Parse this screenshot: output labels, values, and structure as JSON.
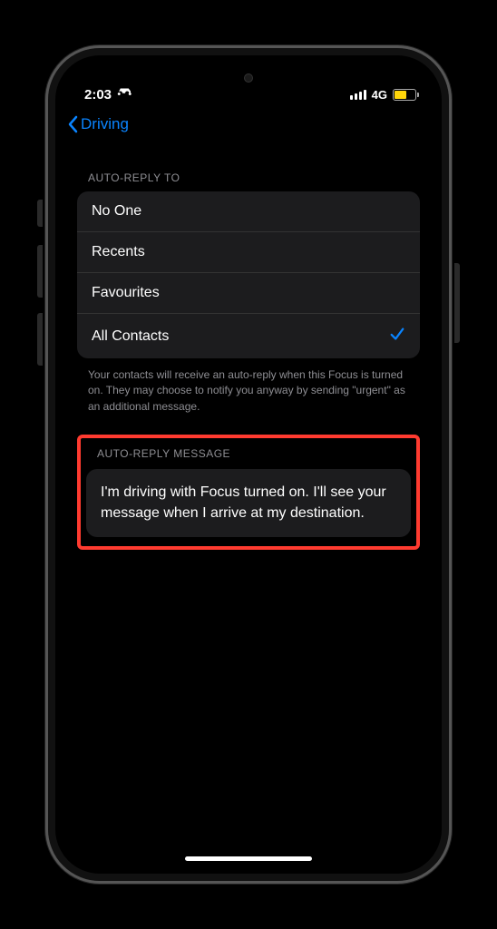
{
  "status": {
    "time": "2:03",
    "network_label": "4G"
  },
  "nav": {
    "back_label": "Driving"
  },
  "sections": {
    "auto_reply_to": {
      "header": "Auto-Reply To",
      "options": [
        {
          "label": "No One"
        },
        {
          "label": "Recents"
        },
        {
          "label": "Favourites"
        },
        {
          "label": "All Contacts"
        }
      ],
      "selected_index": 3,
      "footer": "Your contacts will receive an auto-reply when this Focus is turned on. They may choose to notify you anyway by sending \"urgent\" as an additional message."
    },
    "auto_reply_message": {
      "header": "Auto-Reply Message",
      "text": "I'm driving with Focus turned on. I'll see your message when I arrive at my destination."
    }
  },
  "colors": {
    "accent": "#0a84ff",
    "highlight_border": "#ff3b30",
    "battery_fill": "#ffd60a"
  }
}
